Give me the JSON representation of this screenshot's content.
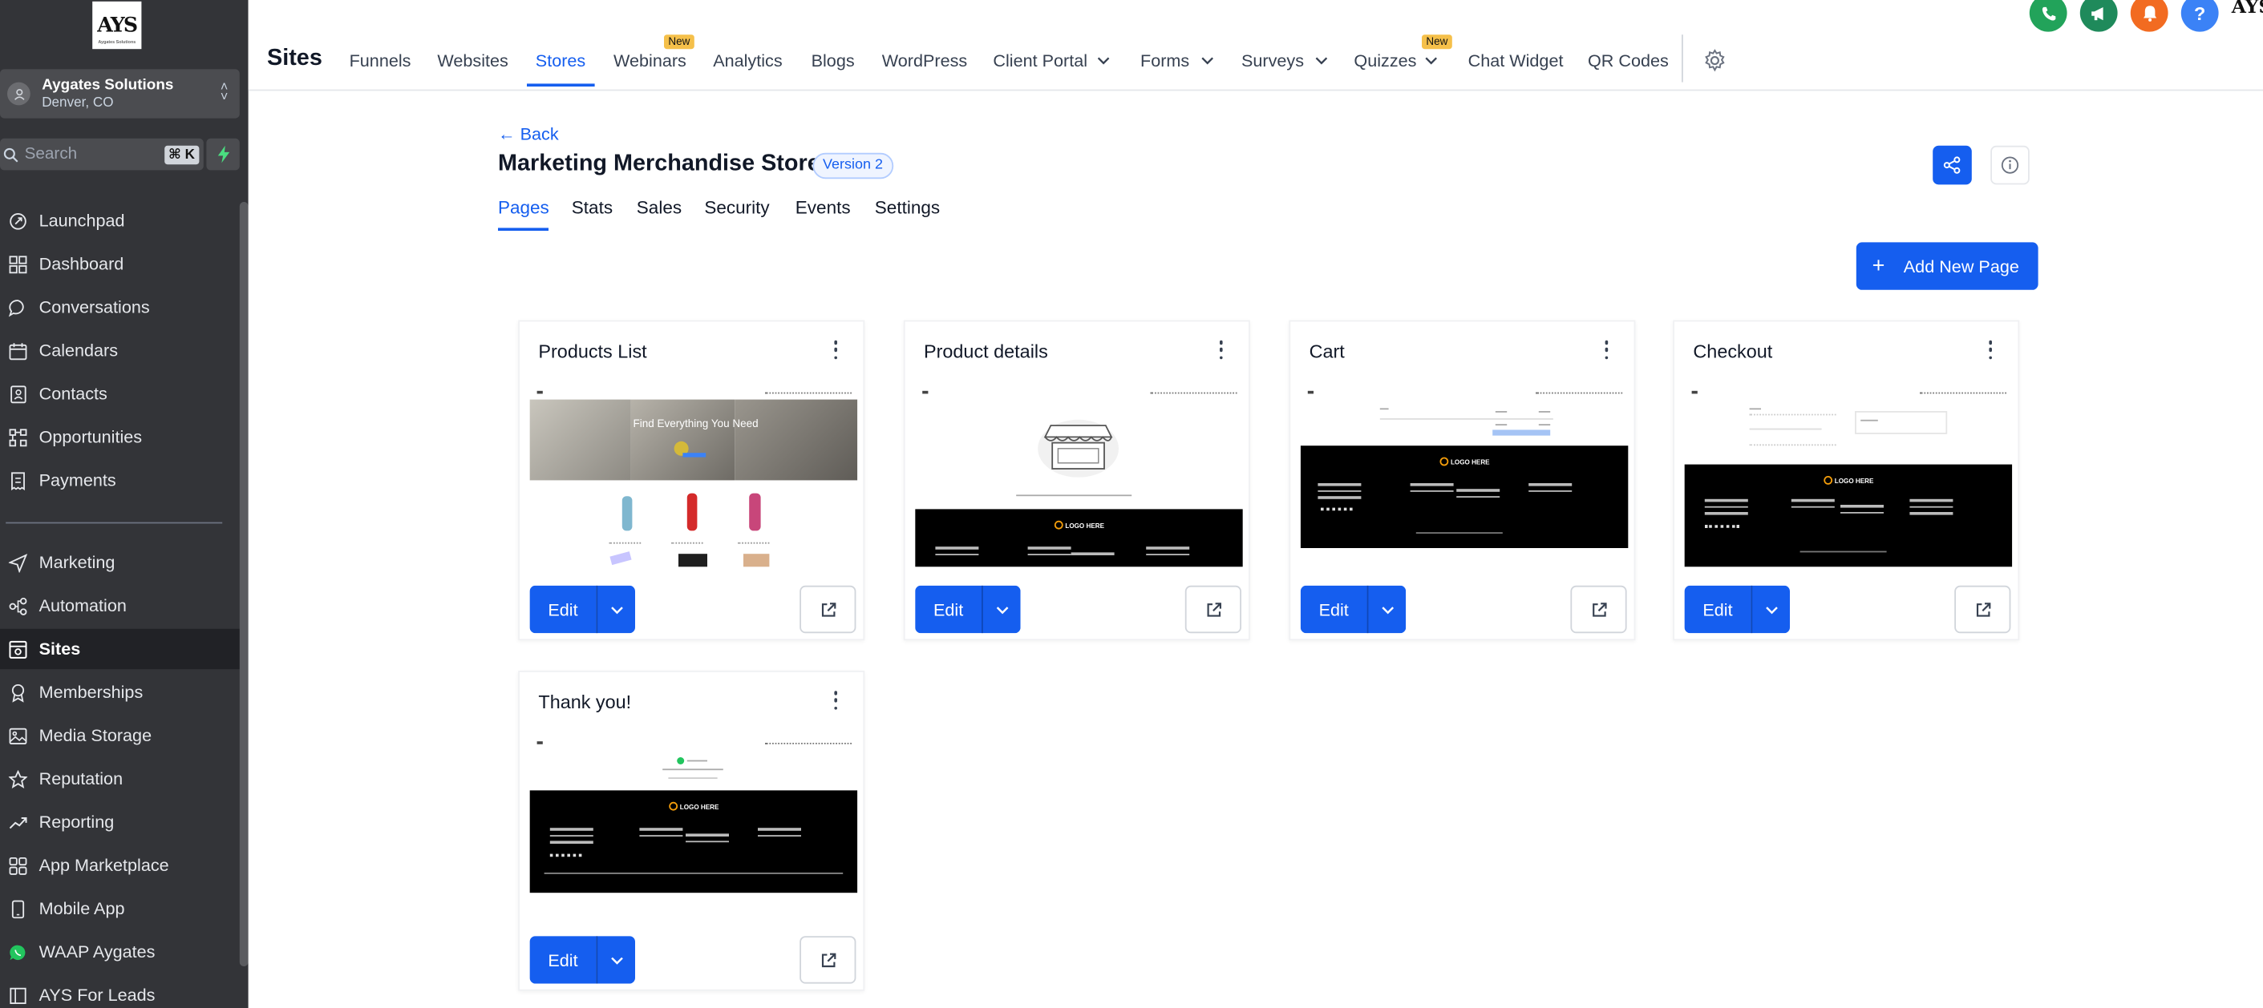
{
  "sidebar": {
    "logo": "AYS",
    "logo_sub": "Aygates Solutions",
    "account_name": "Aygates Solutions",
    "account_location": "Denver, CO",
    "search_placeholder": "Search",
    "search_shortcut": "⌘ K",
    "items": [
      {
        "label": "Launchpad",
        "icon": "rocket-icon"
      },
      {
        "label": "Dashboard",
        "icon": "grid-icon"
      },
      {
        "label": "Conversations",
        "icon": "chat-icon"
      },
      {
        "label": "Calendars",
        "icon": "calendar-icon"
      },
      {
        "label": "Contacts",
        "icon": "contacts-icon"
      },
      {
        "label": "Opportunities",
        "icon": "funnel-icon"
      },
      {
        "label": "Payments",
        "icon": "receipt-icon"
      },
      {
        "label": "Marketing",
        "icon": "send-icon"
      },
      {
        "label": "Automation",
        "icon": "automation-icon"
      },
      {
        "label": "Sites",
        "icon": "sites-icon"
      },
      {
        "label": "Memberships",
        "icon": "award-icon"
      },
      {
        "label": "Media Storage",
        "icon": "image-icon"
      },
      {
        "label": "Reputation",
        "icon": "star-icon"
      },
      {
        "label": "Reporting",
        "icon": "trend-icon"
      },
      {
        "label": "App Marketplace",
        "icon": "apps-icon"
      },
      {
        "label": "Mobile App",
        "icon": "phone-icon"
      },
      {
        "label": "WAAP Aygates",
        "icon": "whatsapp-icon"
      },
      {
        "label": "AYS For Leads",
        "icon": "leads-icon"
      }
    ],
    "active_item": "Sites"
  },
  "topnav": {
    "title": "Sites",
    "tabs": [
      {
        "label": "Funnels"
      },
      {
        "label": "Websites"
      },
      {
        "label": "Stores",
        "active": true
      },
      {
        "label": "Webinars",
        "badge": "New"
      },
      {
        "label": "Analytics"
      },
      {
        "label": "Blogs"
      },
      {
        "label": "WordPress"
      },
      {
        "label": "Client Portal",
        "dropdown": true
      },
      {
        "label": "Forms",
        "dropdown": true
      },
      {
        "label": "Surveys",
        "dropdown": true
      },
      {
        "label": "Quizzes",
        "dropdown": true,
        "badge": "New"
      },
      {
        "label": "Chat Widget"
      },
      {
        "label": "QR Codes"
      }
    ],
    "corner_text": "AYS",
    "colors": {
      "phone": "#22a35a",
      "megaphone": "#1f8a5b",
      "bell": "#f26b21",
      "help": "#3b82f6"
    }
  },
  "store": {
    "back_label": "← Back",
    "name": "Marketing Merchandise Store",
    "version": "Version 2",
    "tabs": [
      "Pages",
      "Stats",
      "Sales",
      "Security",
      "Events",
      "Settings"
    ],
    "active_tab": "Pages",
    "add_button": "Add New Page"
  },
  "pages": [
    {
      "title": "Products List",
      "edit_label": "Edit",
      "thumb_hero": "Find Everything You Need"
    },
    {
      "title": "Product details",
      "edit_label": "Edit",
      "thumb_logo": "LOGO HERE"
    },
    {
      "title": "Cart",
      "edit_label": "Edit",
      "thumb_logo": "LOGO HERE"
    },
    {
      "title": "Checkout",
      "edit_label": "Edit",
      "thumb_logo": "LOGO HERE"
    },
    {
      "title": "Thank you!",
      "edit_label": "Edit",
      "thumb_logo": "LOGO HERE"
    }
  ],
  "accent_color": "#155eef"
}
